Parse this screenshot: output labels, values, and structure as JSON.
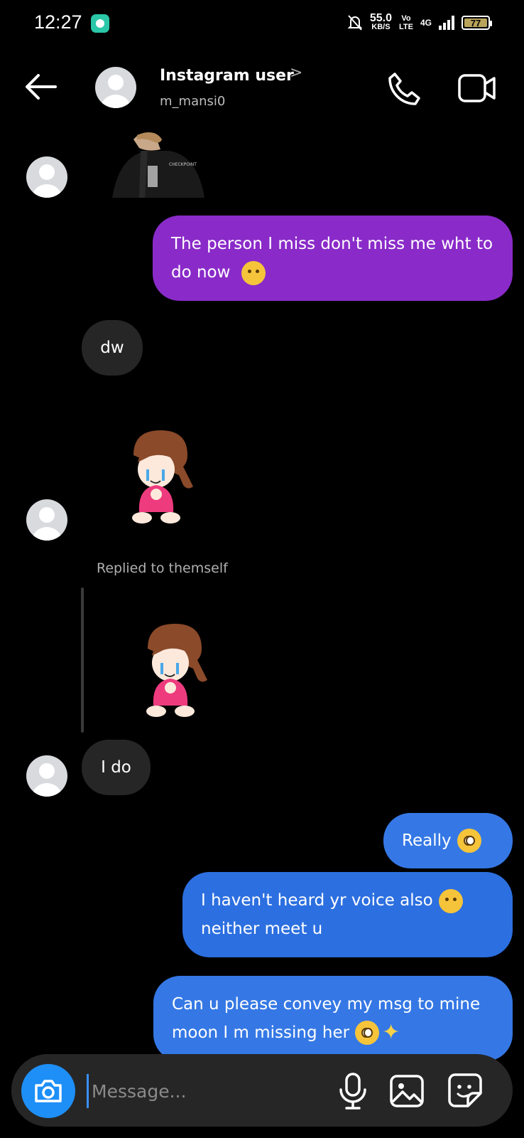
{
  "status_bar": {
    "time": "12:27",
    "speed_value": "55.0",
    "speed_unit": "KB/S",
    "volte_top": "Vo",
    "volte_bottom": "LTE",
    "network": "4G",
    "battery": "77"
  },
  "header": {
    "name": "Instagram user",
    "username": "m_mansi0",
    "chevron": ">"
  },
  "messages": [
    {
      "id": "m1",
      "direction": "outgoing",
      "text": "The person I miss don't miss me wht to do now",
      "emoji": "disappointed-face"
    },
    {
      "id": "m2",
      "direction": "incoming",
      "text": "dw"
    },
    {
      "id": "m3",
      "direction": "incoming",
      "type": "sticker",
      "description": "crying-girl-sticker"
    },
    {
      "id": "m4",
      "direction": "incoming",
      "reply_label": "Replied to themself",
      "text": "I do"
    },
    {
      "id": "m5",
      "direction": "outgoing",
      "text": "Really",
      "emoji": "pleading-face"
    },
    {
      "id": "m6",
      "direction": "outgoing",
      "text_line1": "I haven't heard yr voice also",
      "text_line2": "neither meet u",
      "emoji": "pensive-face"
    },
    {
      "id": "m7",
      "direction": "outgoing",
      "text_line1": "Can u please convey my msg to mine",
      "text_line2": "moon I m missing her",
      "emoji": "pleading-face",
      "emoji2": "sparkles"
    }
  ],
  "composer": {
    "placeholder": "Message..."
  },
  "colors": {
    "background": "#000000",
    "incoming_bubble": "#262626",
    "outgoing_purple": "#8a2bc9",
    "outgoing_blue": "#3578e5",
    "camera_button": "#1e8ff7"
  },
  "icons": [
    "back-arrow-icon",
    "phone-icon",
    "video-camera-icon",
    "camera-icon",
    "microphone-icon",
    "gallery-icon",
    "sticker-icon"
  ]
}
